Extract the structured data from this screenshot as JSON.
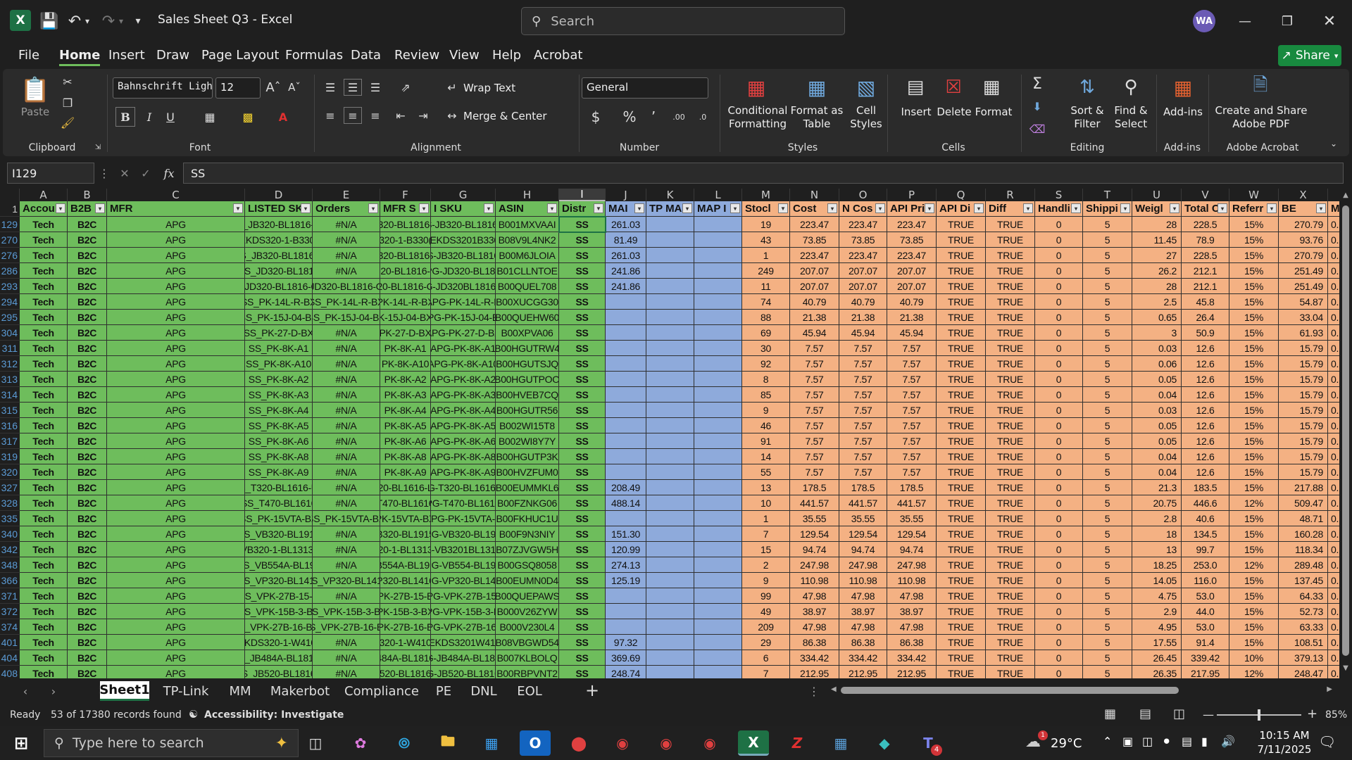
{
  "window": {
    "title": "Sales Sheet Q3 - Excel",
    "search_placeholder": "Search",
    "user_initials": "WA"
  },
  "menu": [
    "File",
    "Home",
    "Insert",
    "Draw",
    "Page Layout",
    "Formulas",
    "Data",
    "Review",
    "View",
    "Help",
    "Acrobat"
  ],
  "share_label": "Share",
  "ribbon": {
    "paste": "Paste",
    "font_name": "Bahnschrift Light C",
    "font_size": "12",
    "wrap_text": "Wrap Text",
    "merge_center": "Merge & Center",
    "number_format": "General",
    "conditional_formatting": [
      "Conditional",
      "Formatting"
    ],
    "format_as_table": [
      "Format as",
      "Table"
    ],
    "cell_styles": [
      "Cell",
      "Styles"
    ],
    "insert": "Insert",
    "delete": "Delete",
    "format": "Format",
    "sort_filter": [
      "Sort &",
      "Filter"
    ],
    "find_select": [
      "Find &",
      "Select"
    ],
    "add_ins": "Add-ins",
    "create_pdf": [
      "Create and Share",
      "Adobe PDF"
    ],
    "groups": {
      "clipboard": "Clipboard",
      "font": "Font",
      "alignment": "Alignment",
      "number": "Number",
      "styles": "Styles",
      "cells": "Cells",
      "editing": "Editing",
      "addins": "Add-ins",
      "acrobat": "Adobe Acrobat"
    }
  },
  "formula_bar": {
    "name_box": "I129",
    "content": "SS"
  },
  "columns": [
    "A",
    "B",
    "C",
    "D",
    "E",
    "F",
    "G",
    "H",
    "I",
    "J",
    "K",
    "L",
    "M",
    "N",
    "O",
    "P",
    "Q",
    "R",
    "S",
    "T",
    "U",
    "V",
    "W",
    "X"
  ],
  "headers": [
    "Accou",
    "B2B",
    "MFR",
    "LISTED SK",
    "Orders",
    "MFR S",
    "I SKU",
    "ASIN",
    "Distr",
    "MAI",
    "TP MA",
    "MAP I",
    "Stocl",
    "Cost",
    "N Cos",
    "API Pri",
    "API Di",
    "Diff",
    "Handli",
    "Shippi",
    "Weigl",
    "Total C",
    "Referr",
    "BE",
    "MAP"
  ],
  "rows": [
    {
      "n": "129",
      "d": "S_JB320-BL1816-N",
      "f": "320-BL1816-",
      "g": "S-JB320-BL1816-",
      "h": "B001MXVAAI",
      "j": "261.03",
      "m": "19",
      "c": "223.47",
      "u": "28",
      "v": "228.5",
      "w": "15%",
      "x": "270.79"
    },
    {
      "n": "270",
      "d": "EKDS320-1-B330-",
      "f": "320-1-B330(",
      "g": "-EKDS3201B330",
      "h": "B08V9L4NK2",
      "j": "81.49",
      "m": "43",
      "c": "73.85",
      "u": "11.45",
      "v": "78.9",
      "w": "15%",
      "x": "93.76"
    },
    {
      "n": "276",
      "d": "S_JB320-BL1816-",
      "f": "320-BL1816-",
      "g": "S-JB320-BL1816",
      "h": "B00M6JLOIA",
      "j": "261.03",
      "m": "1",
      "c": "223.47",
      "u": "27",
      "v": "228.5",
      "w": "15%",
      "x": "270.79"
    },
    {
      "n": "286",
      "d": "SS_JD320-BL1816",
      "f": "20-BL1816-",
      "g": "PG-JD320-BL181",
      "h": "B01CLLNTOE",
      "j": "241.86",
      "m": "249",
      "c": "207.07",
      "u": "26.2",
      "v": "212.1",
      "w": "15%",
      "x": "251.49"
    },
    {
      "n": "293",
      "d": "_JD320-BL1816-C",
      "e": "JD320-BL1816-C",
      "f": "20-BL1816-C",
      "g": "G-JD320BL18160",
      "h": "B00QUEL708",
      "j": "241.86",
      "m": "11",
      "c": "207.07",
      "u": "28",
      "v": "212.1",
      "w": "15%",
      "x": "251.49"
    },
    {
      "n": "294",
      "d": "SS_PK-14L-R-BX",
      "e": "SS_PK-14L-R-BX",
      "f": "PK-14L-R-BX",
      "g": "APG-PK-14L-R-B",
      "h": "B00XUCGG30",
      "j": "",
      "m": "74",
      "c": "40.79",
      "u": "2.5",
      "v": "45.8",
      "w": "15%",
      "x": "54.87"
    },
    {
      "n": "295",
      "d": "SS_PK-15J-04-BX",
      "e": "SS_PK-15J-04-BX",
      "f": "K-15J-04-BX",
      "g": "PG-PK-15J-04-E",
      "h": "B00QUEHW60",
      "j": "",
      "m": "88",
      "c": "21.38",
      "u": "0.65",
      "v": "26.4",
      "w": "15%",
      "x": "33.04"
    },
    {
      "n": "304",
      "d": "SS_PK-27-D-BX",
      "f": "PK-27-D-BX",
      "g": "APG-PK-27-D-BX",
      "h": "B00XPVA06",
      "j": "",
      "m": "69",
      "c": "45.94",
      "u": "3",
      "v": "50.9",
      "w": "15%",
      "x": "61.93"
    },
    {
      "n": "311",
      "d": "SS_PK-8K-A1",
      "f": "PK-8K-A1",
      "g": "APG-PK-8K-A1",
      "h": "B00HGUTRW4",
      "j": "",
      "m": "30",
      "c": "7.57",
      "u": "0.03",
      "v": "12.6",
      "w": "15%",
      "x": "15.79"
    },
    {
      "n": "312",
      "d": "SS_PK-8K-A10",
      "f": "PK-8K-A10",
      "g": "APG-PK-8K-A10",
      "h": "B00HGUTSJQ",
      "j": "",
      "m": "92",
      "c": "7.57",
      "u": "0.06",
      "v": "12.6",
      "w": "15%",
      "x": "15.79"
    },
    {
      "n": "313",
      "d": "SS_PK-8K-A2",
      "f": "PK-8K-A2",
      "g": "APG-PK-8K-A2",
      "h": "B00HGUTPOO",
      "j": "",
      "m": "8",
      "c": "7.57",
      "u": "0.05",
      "v": "12.6",
      "w": "15%",
      "x": "15.79"
    },
    {
      "n": "314",
      "d": "SS_PK-8K-A3",
      "f": "PK-8K-A3",
      "g": "APG-PK-8K-A3",
      "h": "B00HVEB7CQ",
      "j": "",
      "m": "85",
      "c": "7.57",
      "u": "0.04",
      "v": "12.6",
      "w": "15%",
      "x": "15.79"
    },
    {
      "n": "315",
      "d": "SS_PK-8K-A4",
      "f": "PK-8K-A4",
      "g": "APG-PK-8K-A4",
      "h": "B00HGUTR56",
      "j": "",
      "m": "9",
      "c": "7.57",
      "u": "0.03",
      "v": "12.6",
      "w": "15%",
      "x": "15.79"
    },
    {
      "n": "316",
      "d": "SS_PK-8K-A5",
      "f": "PK-8K-A5",
      "g": "APG-PK-8K-A5",
      "h": "B002WI15T8",
      "j": "",
      "m": "46",
      "c": "7.57",
      "u": "0.05",
      "v": "12.6",
      "w": "15%",
      "x": "15.79"
    },
    {
      "n": "317",
      "d": "SS_PK-8K-A6",
      "f": "PK-8K-A6",
      "g": "APG-PK-8K-A6",
      "h": "B002WI8Y7Y",
      "j": "",
      "m": "91",
      "c": "7.57",
      "u": "0.05",
      "v": "12.6",
      "w": "15%",
      "x": "15.79"
    },
    {
      "n": "319",
      "d": "SS_PK-8K-A8",
      "f": "PK-8K-A8",
      "g": "APG-PK-8K-A8",
      "h": "B00HGUTP3K",
      "j": "",
      "m": "14",
      "c": "7.57",
      "u": "0.04",
      "v": "12.6",
      "w": "15%",
      "x": "15.79"
    },
    {
      "n": "320",
      "d": "SS_PK-8K-A9",
      "f": "PK-8K-A9",
      "g": "APG-PK-8K-A9",
      "h": "B00HVZFUM0",
      "j": "",
      "m": "55",
      "c": "7.57",
      "u": "0.04",
      "v": "12.6",
      "w": "15%",
      "x": "15.79"
    },
    {
      "n": "327",
      "d": "S_T320-BL1616-U",
      "f": "20-BL1616-L",
      "g": "G-T320-BL1616-",
      "h": "B00EUMMKL6",
      "j": "208.49",
      "m": "13",
      "c": "178.5",
      "u": "21.3",
      "v": "183.5",
      "w": "15%",
      "x": "217.88"
    },
    {
      "n": "328",
      "d": "SS_T470-BL1616",
      "f": "T470-BL1616",
      "g": "PG-T470-BL1616",
      "h": "B00FZNKG06",
      "j": "488.14",
      "m": "10",
      "c": "441.57",
      "u": "20.75",
      "v": "446.6",
      "w": "12%",
      "x": "509.47"
    },
    {
      "n": "335",
      "d": "SS_PK-15VTA-BX",
      "e": "SS_PK-15VTA-BX",
      "f": "PK-15VTA-BX",
      "g": "APG-PK-15VTA-E",
      "h": "B00FKHUC1U",
      "j": "",
      "m": "1",
      "c": "35.55",
      "u": "2.8",
      "v": "40.6",
      "w": "15%",
      "x": "48.71"
    },
    {
      "n": "340",
      "d": "SS_VB320-BL1915",
      "f": "B320-BL1915",
      "g": "PG-VB320-BL191",
      "h": "B00F9N3NIY",
      "j": "151.30",
      "m": "7",
      "c": "129.54",
      "u": "18",
      "v": "134.5",
      "w": "15%",
      "x": "160.28"
    },
    {
      "n": "342",
      "d": "VB320-1-BL1313-",
      "f": "20-1-BL1313",
      "g": "S-VB3201BL1313",
      "h": "B07ZJVGW5H",
      "j": "120.99",
      "m": "15",
      "c": "94.74",
      "u": "13",
      "v": "99.7",
      "w": "15%",
      "x": "118.34"
    },
    {
      "n": "348",
      "d": "SS_VB554A-BL191",
      "f": "B554A-BL191",
      "g": "PG-VB554-BL191",
      "h": "B00GSQ8058",
      "j": "274.13",
      "m": "2",
      "c": "247.98",
      "u": "18.25",
      "v": "253.0",
      "w": "12%",
      "x": "289.48"
    },
    {
      "n": "366",
      "d": "SS_VP320-BL1416",
      "e": "SS_VP320-BL1416",
      "f": "P320-BL1416",
      "g": "PG-VP320-BL141",
      "h": "B00EUMN0D4",
      "j": "125.19",
      "m": "9",
      "c": "110.98",
      "u": "14.05",
      "v": "116.0",
      "w": "15%",
      "x": "137.45"
    },
    {
      "n": "371",
      "d": "SS_VPK-27B-15-B",
      "f": "PK-27B-15-B",
      "g": "PG-VPK-27B-15-",
      "h": "B00QUEPAWS",
      "j": "",
      "m": "99",
      "c": "47.98",
      "u": "4.75",
      "v": "53.0",
      "w": "15%",
      "x": "64.33"
    },
    {
      "n": "372",
      "d": "SS_VPK-15B-3-BX",
      "e": "SS_VPK-15B-3-BX",
      "f": "PK-15B-3-BX",
      "g": "PG-VPK-15B-3-E",
      "h": "B000V26ZYW",
      "j": "",
      "m": "49",
      "c": "38.97",
      "u": "2.9",
      "v": "44.0",
      "w": "15%",
      "x": "52.73"
    },
    {
      "n": "374",
      "d": "S_VPK-27B-16-BX",
      "e": "SS_VPK-27B-16-BX",
      "f": "PK-27B-16-E",
      "g": "PG-VPK-27B-16-",
      "h": "B000V230L4",
      "j": "",
      "m": "209",
      "c": "47.98",
      "u": "4.95",
      "v": "53.0",
      "w": "15%",
      "x": "63.33"
    },
    {
      "n": "401",
      "d": "EKDS320-1-W410-",
      "f": "320-1-W410",
      "g": "-EKDS3201W410",
      "h": "B08VBGWD54",
      "j": "97.32",
      "m": "29",
      "c": "86.38",
      "u": "17.55",
      "v": "91.4",
      "w": "15%",
      "x": "108.51"
    },
    {
      "n": "404",
      "d": "S_JB484A-BL1816",
      "f": "484A-BL1816",
      "g": "G-JB484A-BL181",
      "h": "B007KLBOLQ",
      "j": "369.69",
      "m": "6",
      "c": "334.42",
      "u": "26.45",
      "v": "339.42",
      "w": "10%",
      "x": "379.13"
    },
    {
      "n": "408",
      "d": "S_JB520-BL1816",
      "f": "520-BL1816",
      "g": "G-JB520-BL1816",
      "h": "B00RBPVNT2",
      "j": "248.74",
      "m": "7",
      "c": "212.95",
      "u": "26.35",
      "v": "217.95",
      "w": "12%",
      "x": "248.47"
    }
  ],
  "constants": {
    "account": "Tech",
    "b2b": "B2C",
    "mfr": "APG",
    "orders": "#N/A",
    "distr": "SS",
    "api_diff": "TRUE",
    "diff": "TRUE",
    "handling": "0",
    "shipping": "5",
    "map_prefix": "0."
  },
  "sheets": [
    "Sheet1",
    "TP-Link",
    "MM",
    "Makerbot",
    "Compliance",
    "PE",
    "DNL",
    "EOL"
  ],
  "status": {
    "ready": "Ready",
    "records": "53 of 17380 records found",
    "accessibility": "Accessibility: Investigate",
    "zoom": "85%"
  },
  "taskbar": {
    "search_placeholder": "Type here to search",
    "weather": "29°C",
    "time": "10:15 AM",
    "date": "7/11/2025",
    "weather_badge": "1",
    "notif_badge": "4"
  },
  "colors": {
    "green_cells": "#6ebd5c",
    "blue_cells": "#8eaadb",
    "orange_cells": "#f4b183",
    "excel_green": "#1e7145"
  }
}
